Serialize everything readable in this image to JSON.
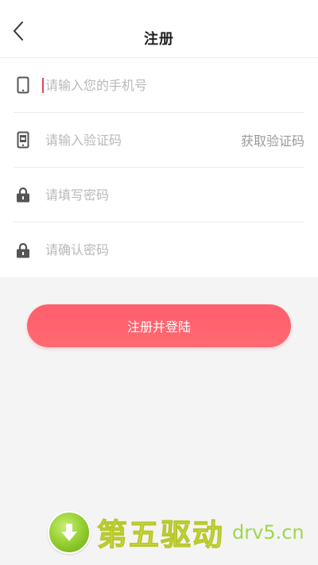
{
  "header": {
    "title": "注册"
  },
  "form": {
    "phone_placeholder": "请输入您的手机号",
    "code_placeholder": "请输入验证码",
    "get_code_label": "获取验证码",
    "password_placeholder": "请填写密码",
    "confirm_placeholder": "请确认密码"
  },
  "actions": {
    "submit_label": "注册并登陆"
  },
  "watermark": {
    "text": "第五驱动",
    "url": "drv5.cn"
  },
  "colors": {
    "accent": "#ff5f6d",
    "background": "#f4f4f4",
    "icon": "#555555",
    "watermark": "#d6e84c"
  },
  "icons": {
    "back": "back-chevron-icon",
    "phone": "phone-icon",
    "code": "sms-code-icon",
    "password": "lock-icon",
    "confirm": "lock-icon",
    "watermark_badge": "download-arrow-icon"
  }
}
